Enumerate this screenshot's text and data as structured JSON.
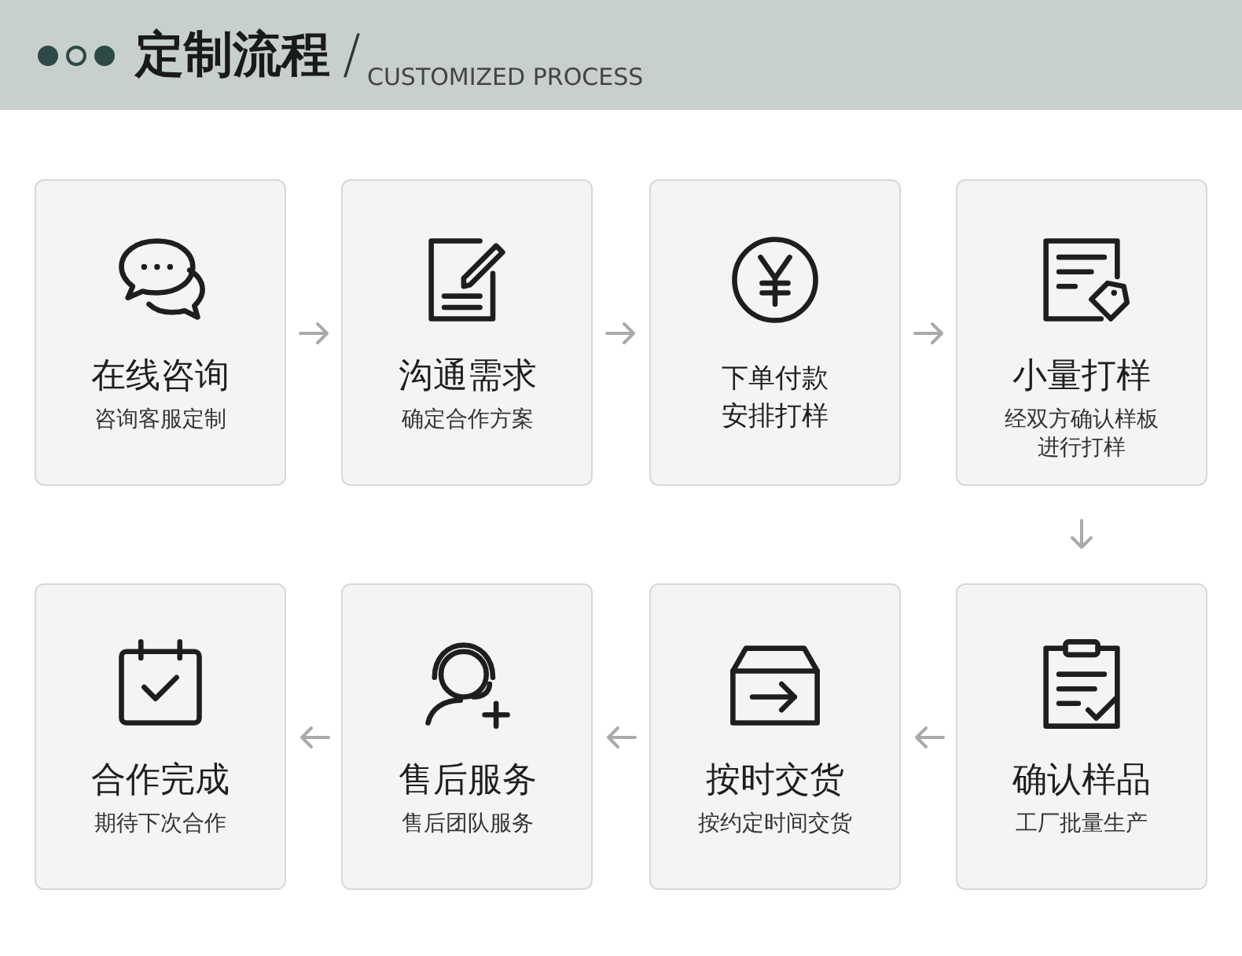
{
  "header": {
    "title": "定制流程",
    "slash": "/",
    "subtitle": "CUSTOMIZED PROCESS",
    "dots": [
      {
        "filled": true
      },
      {
        "filled": false
      },
      {
        "filled": true
      }
    ]
  },
  "rows": [
    {
      "kind": "right",
      "steps": [
        {
          "kind": "standard",
          "title": "在线咨询",
          "subtitle": [
            "咨询客服定制"
          ]
        },
        {
          "kind": "standard",
          "title": "沟通需求",
          "subtitle": [
            "确定合作方案"
          ]
        },
        {
          "kind": "compact",
          "title": "下单付款",
          "subtitle": [
            "安排打样"
          ]
        },
        {
          "kind": "standard",
          "title": "小量打样",
          "subtitle": [
            "经双方确认样板",
            "进行打样"
          ]
        }
      ]
    },
    {
      "kind": "left",
      "steps": [
        {
          "kind": "standard",
          "title": "合作完成",
          "subtitle": [
            "期待下次合作"
          ]
        },
        {
          "kind": "standard",
          "title": "售后服务",
          "subtitle": [
            "售后团队服务"
          ]
        },
        {
          "kind": "standard",
          "title": "按时交货",
          "subtitle": [
            "按约定时间交货"
          ]
        },
        {
          "kind": "standard",
          "title": "确认样品",
          "subtitle": [
            "工厂批量生产"
          ]
        }
      ]
    }
  ]
}
